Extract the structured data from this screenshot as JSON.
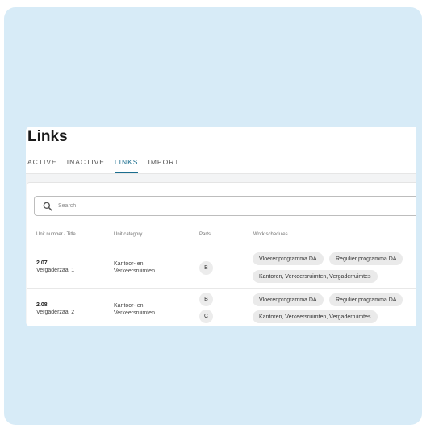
{
  "page": {
    "title": "Links"
  },
  "tabs": [
    {
      "label": "ACTIVE",
      "active": false
    },
    {
      "label": "INACTIVE",
      "active": false
    },
    {
      "label": "LINKS",
      "active": true
    },
    {
      "label": "IMPORT",
      "active": false
    }
  ],
  "search": {
    "placeholder": "Search"
  },
  "table": {
    "headers": [
      "Unit number / Title",
      "Unit category",
      "Parts",
      "Work schedules"
    ],
    "rows": [
      {
        "number": "2.07",
        "title": "Vergaderzaal 1",
        "category": "Kantoor- en Verkeersruimten",
        "parts": [
          "B"
        ],
        "schedules": [
          "Vloerenprogramma DA",
          "Regulier programma DA",
          "Kantoren, Verkeersruimten, Vergaderruimtes"
        ]
      },
      {
        "number": "2.08",
        "title": "Vergaderzaal 2",
        "category": "Kantoor- en Verkeersruimten",
        "parts": [
          "B",
          "C"
        ],
        "schedules": [
          "Vloerenprogramma DA",
          "Regulier programma DA",
          "Kantoren, Verkeersruimten, Vergaderruimtes"
        ]
      }
    ]
  },
  "colors": {
    "accent": "#1b6e8f",
    "background": "#d7ebf7"
  },
  "icons": {
    "search": "search-icon"
  }
}
